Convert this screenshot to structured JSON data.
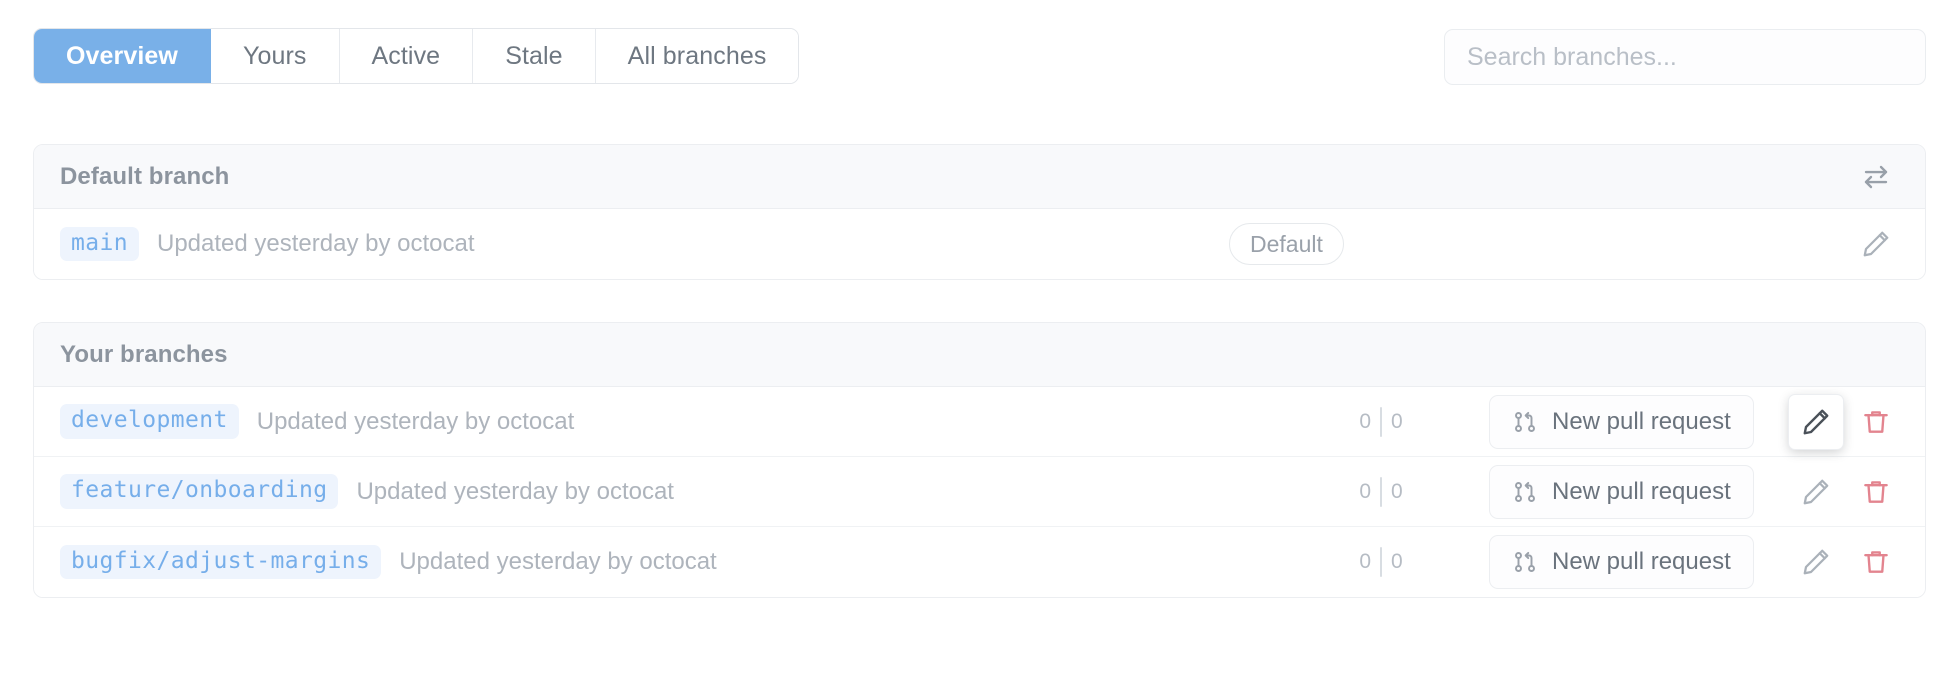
{
  "tabs": [
    {
      "label": "Overview",
      "active": true
    },
    {
      "label": "Yours",
      "active": false
    },
    {
      "label": "Active",
      "active": false
    },
    {
      "label": "Stale",
      "active": false
    },
    {
      "label": "All branches",
      "active": false
    }
  ],
  "search": {
    "placeholder": "Search branches...",
    "value": ""
  },
  "colors": {
    "accent": "#79b0e8",
    "branch_text": "#76aeea",
    "branch_pill_bg": "#eef4fd",
    "danger": "#e3848f",
    "muted_text": "#aeb4bc",
    "header_bg": "#f8f9fb",
    "border": "#eceef1"
  },
  "default_section": {
    "title": "Default branch",
    "header_icon": "swap-arrows-icon",
    "rows": [
      {
        "branch": "main",
        "meta": "Updated yesterday by octocat",
        "badge": "Default",
        "edit_icon": "pencil-icon"
      }
    ]
  },
  "your_section": {
    "title": "Your branches",
    "rows": [
      {
        "branch": "development",
        "meta": "Updated yesterday by octocat",
        "ahead": "0",
        "behind": "0",
        "pr_label": "New pull request",
        "pr_icon": "git-pull-request-icon",
        "edit_icon": "pencil-icon",
        "delete_icon": "trash-icon",
        "edit_focused": true
      },
      {
        "branch": "feature/onboarding",
        "meta": "Updated yesterday by octocat",
        "ahead": "0",
        "behind": "0",
        "pr_label": "New pull request",
        "pr_icon": "git-pull-request-icon",
        "edit_icon": "pencil-icon",
        "delete_icon": "trash-icon",
        "edit_focused": false
      },
      {
        "branch": "bugfix/adjust-margins",
        "meta": "Updated yesterday by octocat",
        "ahead": "0",
        "behind": "0",
        "pr_label": "New pull request",
        "pr_icon": "git-pull-request-icon",
        "edit_icon": "pencil-icon",
        "delete_icon": "trash-icon",
        "edit_focused": false
      }
    ]
  }
}
